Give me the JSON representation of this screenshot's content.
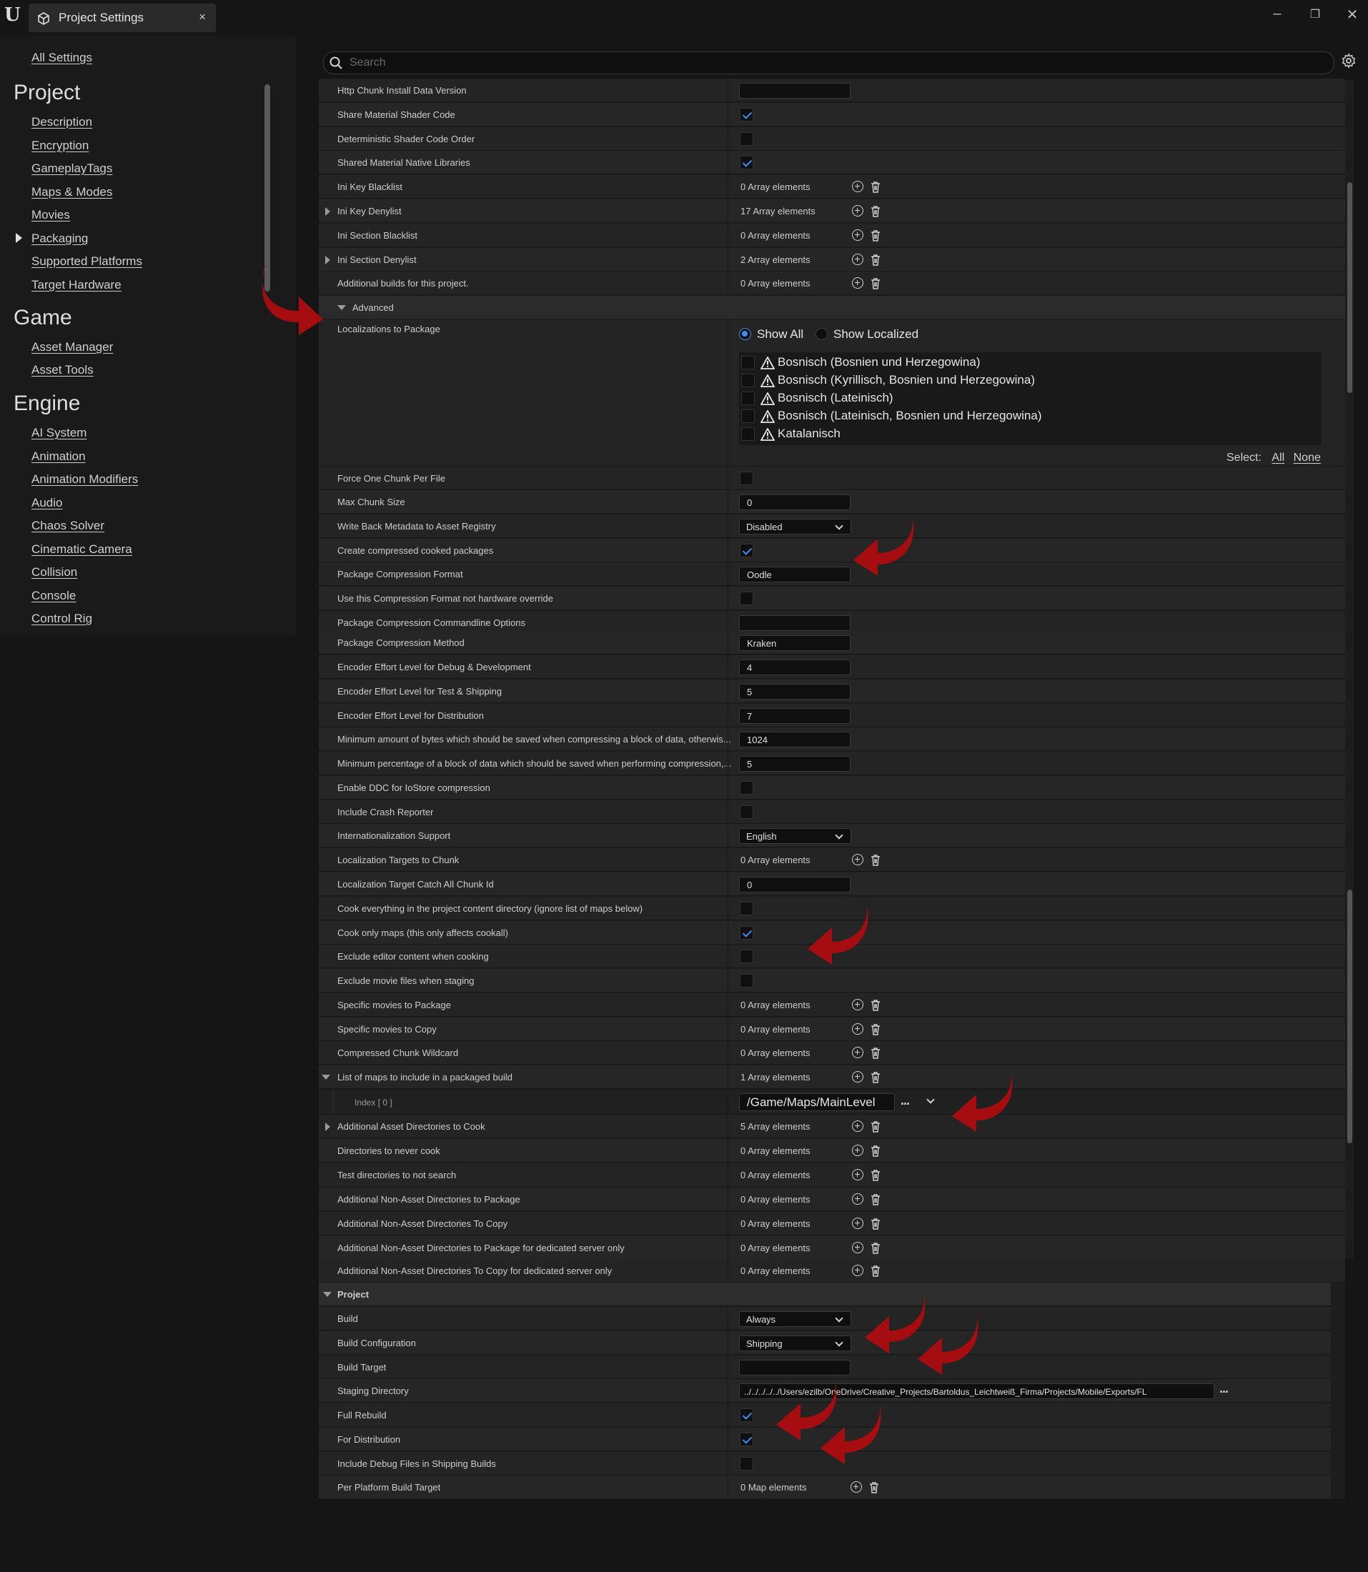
{
  "window": {
    "tab_title": "Project Settings",
    "close_tab": "×",
    "minimize": "–",
    "restore": "❐",
    "close": "✕"
  },
  "sidebar": {
    "all_settings": "All Settings",
    "sections": [
      {
        "heading": "Project",
        "items": [
          "Description",
          "Encryption",
          "GameplayTags",
          "Maps & Modes",
          "Movies",
          "Packaging",
          "Supported Platforms",
          "Target Hardware"
        ]
      },
      {
        "heading": "Game",
        "items": [
          "Asset Manager",
          "Asset Tools"
        ]
      },
      {
        "heading": "Engine",
        "items": [
          "AI System",
          "Animation",
          "Animation Modifiers",
          "Audio",
          "Chaos Solver",
          "Cinematic Camera",
          "Collision",
          "Console",
          "Control Rig"
        ]
      }
    ],
    "selected": "Packaging"
  },
  "search": {
    "placeholder": "Search"
  },
  "rows": {
    "http_chunk": {
      "label": "Http Chunk Install Data Version",
      "value": ""
    },
    "share_material": {
      "label": "Share Material Shader Code",
      "checked": true
    },
    "deterministic": {
      "label": "Deterministic Shader Code Order",
      "checked": false
    },
    "shared_native": {
      "label": "Shared Material Native Libraries",
      "checked": true
    },
    "ini_key_blacklist": {
      "label": "Ini Key Blacklist",
      "value": "0 Array elements"
    },
    "ini_key_denylist": {
      "label": "Ini Key Denylist",
      "value": "17 Array elements"
    },
    "ini_section_blacklist": {
      "label": "Ini Section Blacklist",
      "value": "0 Array elements"
    },
    "ini_section_denylist": {
      "label": "Ini Section Denylist",
      "value": "2 Array elements"
    },
    "additional_builds": {
      "label": "Additional builds for this project.",
      "value": "0 Array elements"
    },
    "advanced": {
      "label": "Advanced"
    },
    "localizations": {
      "label": "Localizations to Package",
      "show_all": "Show All",
      "show_localized": "Show Localized",
      "items": [
        "Bosnisch (Bosnien und Herzegowina)",
        "Bosnisch (Kyrillisch, Bosnien und Herzegowina)",
        "Bosnisch (Lateinisch)",
        "Bosnisch (Lateinisch, Bosnien und Herzegowina)",
        "Katalanisch"
      ],
      "select_label": "Select:",
      "select_all": "All",
      "select_none": "None"
    },
    "force_one_chunk": {
      "label": "Force One Chunk Per File",
      "checked": false
    },
    "max_chunk_size": {
      "label": "Max Chunk Size",
      "value": "0"
    },
    "write_back_metadata": {
      "label": "Write Back Metadata to Asset Registry",
      "value": "Disabled"
    },
    "create_compressed": {
      "label": "Create compressed cooked packages",
      "checked": true
    },
    "compression_format": {
      "label": "Package Compression Format",
      "value": "Oodle"
    },
    "use_compression_format": {
      "label": "Use this Compression Format not hardware override",
      "checked": false
    },
    "compression_cmdline": {
      "label": "Package Compression Commandline Options",
      "value": ""
    },
    "compression_method": {
      "label": "Package Compression Method",
      "value": "Kraken"
    },
    "effort_debug": {
      "label": "Encoder Effort Level for Debug & Development",
      "value": "4"
    },
    "effort_test": {
      "label": "Encoder Effort Level for Test & Shipping",
      "value": "5"
    },
    "effort_dist": {
      "label": "Encoder Effort Level for Distribution",
      "value": "7"
    },
    "min_bytes": {
      "label": "Minimum amount of bytes which should be saved when compressing a block of data, otherwis...",
      "value": "1024"
    },
    "min_percent": {
      "label": "Minimum percentage of a block of data which should be saved when performing compression,...",
      "value": "5"
    },
    "enable_ddc": {
      "label": "Enable DDC for IoStore compression",
      "checked": false
    },
    "include_crash": {
      "label": "Include Crash Reporter",
      "checked": false
    },
    "i18n_support": {
      "label": "Internationalization Support",
      "value": "English"
    },
    "loc_targets_chunk": {
      "label": "Localization Targets to Chunk",
      "value": "0 Array elements"
    },
    "loc_catch_all": {
      "label": "Localization Target Catch All Chunk Id",
      "value": "0"
    },
    "cook_everything": {
      "label": "Cook everything in the project content directory (ignore list of maps below)",
      "checked": false
    },
    "cook_only_maps": {
      "label": "Cook only maps (this only affects cookall)",
      "checked": true
    },
    "exclude_editor": {
      "label": "Exclude editor content when cooking",
      "checked": false
    },
    "exclude_movie": {
      "label": "Exclude movie files when staging",
      "checked": false
    },
    "specific_movies_package": {
      "label": "Specific movies to Package",
      "value": "0 Array elements"
    },
    "specific_movies_copy": {
      "label": "Specific movies to Copy",
      "value": "0 Array elements"
    },
    "compressed_chunk": {
      "label": "Compressed Chunk Wildcard",
      "value": "0 Array elements"
    },
    "list_of_maps": {
      "label": "List of maps to include in a packaged build",
      "value": "1 Array elements"
    },
    "map_index": {
      "label": "Index [ 0 ]",
      "value": "/Game/Maps/MainLevel"
    },
    "additional_asset_dirs": {
      "label": "Additional Asset Directories to Cook",
      "value": "5 Array elements"
    },
    "dirs_never_cook": {
      "label": "Directories to never cook",
      "value": "0 Array elements"
    },
    "test_dirs": {
      "label": "Test directories to not search",
      "value": "0 Array elements"
    },
    "nonasset_package": {
      "label": "Additional Non-Asset Directories to Package",
      "value": "0 Array elements"
    },
    "nonasset_copy": {
      "label": "Additional Non-Asset Directories To Copy",
      "value": "0 Array elements"
    },
    "nonasset_package_server": {
      "label": "Additional Non-Asset Directories to Package for dedicated server only",
      "value": "0 Array elements"
    },
    "nonasset_copy_server": {
      "label": "Additional Non-Asset Directories To Copy for dedicated server only",
      "value": "0 Array elements"
    },
    "project_header": {
      "label": "Project"
    },
    "build": {
      "label": "Build",
      "value": "Always"
    },
    "build_config": {
      "label": "Build Configuration",
      "value": "Shipping"
    },
    "build_target": {
      "label": "Build Target",
      "value": ""
    },
    "staging_dir": {
      "label": "Staging Directory",
      "value": "../../../../../Users/ezilb/OneDrive/Creative_Projects/Bartoldus_Leichtweiß_Firma/Projects/Mobile/Exports/FL"
    },
    "full_rebuild": {
      "label": "Full Rebuild",
      "checked": true
    },
    "for_distribution": {
      "label": "For Distribution",
      "checked": true
    },
    "include_debug": {
      "label": "Include Debug Files in Shipping Builds",
      "checked": false
    },
    "per_platform_target": {
      "label": "Per Platform Build Target",
      "value": "0 Map elements"
    }
  },
  "colors": {
    "accent": "#3d8bf5",
    "annotation_arrow": "#a50d10"
  }
}
